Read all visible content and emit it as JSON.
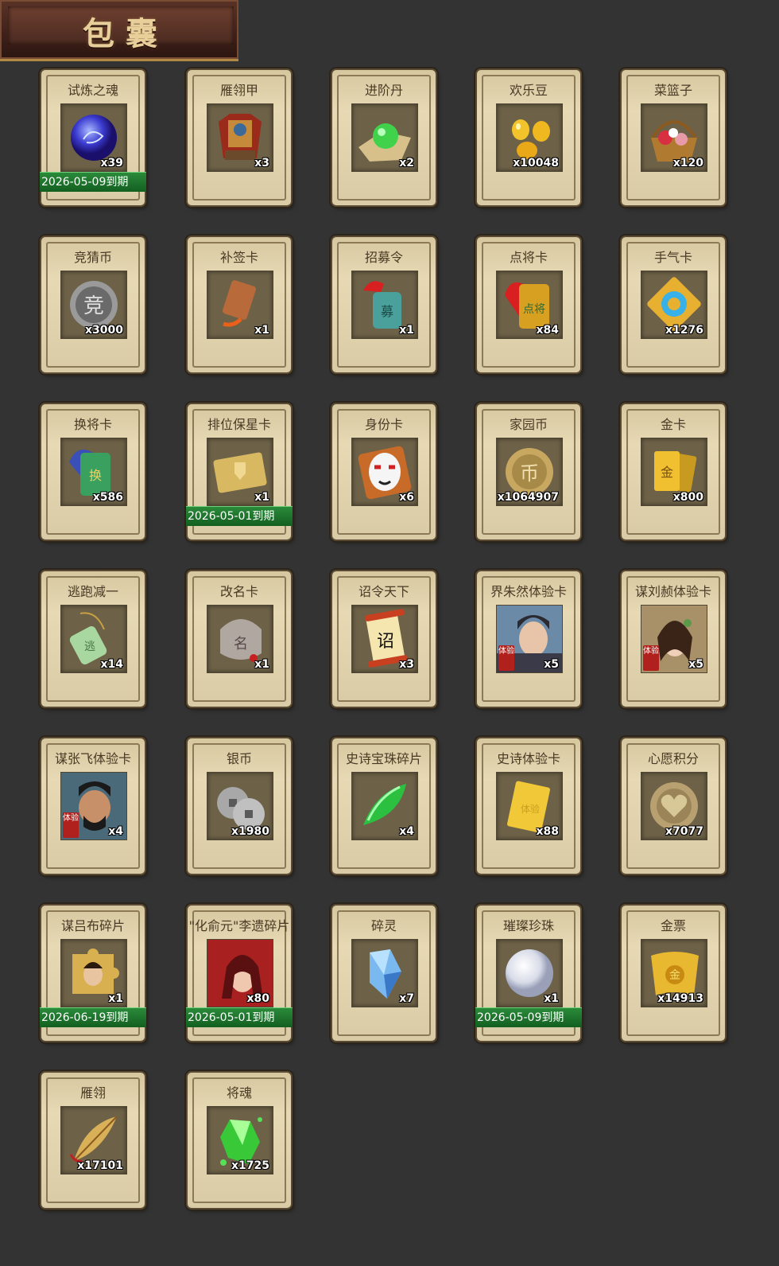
{
  "header": {
    "title": "包囊"
  },
  "items": [
    {
      "name": "试炼之魂",
      "qty": "x39",
      "expiry": "2026-05-09到期",
      "icon": "purple-orb-icon"
    },
    {
      "name": "雁翎甲",
      "qty": "x3",
      "expiry": "",
      "icon": "armor-icon"
    },
    {
      "name": "进阶丹",
      "qty": "x2",
      "expiry": "",
      "icon": "green-pill-icon"
    },
    {
      "name": "欢乐豆",
      "qty": "x10048",
      "expiry": "",
      "icon": "gold-beans-icon"
    },
    {
      "name": "菜篮子",
      "qty": "x120",
      "expiry": "",
      "icon": "flower-basket-icon"
    },
    {
      "name": "竞猜币",
      "qty": "x3000",
      "expiry": "",
      "icon": "silver-coin-icon"
    },
    {
      "name": "补签卡",
      "qty": "x1",
      "expiry": "",
      "icon": "tag-card-icon"
    },
    {
      "name": "招募令",
      "qty": "x1",
      "expiry": "",
      "icon": "recruit-token-icon"
    },
    {
      "name": "点将卡",
      "qty": "x84",
      "expiry": "",
      "icon": "general-card-icon"
    },
    {
      "name": "手气卡",
      "qty": "x1276",
      "expiry": "",
      "icon": "luck-card-icon"
    },
    {
      "name": "换将卡",
      "qty": "x586",
      "expiry": "",
      "icon": "swap-card-icon"
    },
    {
      "name": "排位保星卡",
      "qty": "x1",
      "expiry": "2026-05-01到期",
      "icon": "shield-card-icon"
    },
    {
      "name": "身份卡",
      "qty": "x6",
      "expiry": "",
      "icon": "identity-mask-icon"
    },
    {
      "name": "家园币",
      "qty": "x1064907",
      "expiry": "",
      "icon": "home-coin-icon"
    },
    {
      "name": "金卡",
      "qty": "x800",
      "expiry": "",
      "icon": "gold-card-icon"
    },
    {
      "name": "逃跑减一",
      "qty": "x14",
      "expiry": "",
      "icon": "jade-tablet-icon"
    },
    {
      "name": "改名卡",
      "qty": "x1",
      "expiry": "",
      "icon": "rename-card-icon"
    },
    {
      "name": "诏令天下",
      "qty": "x3",
      "expiry": "",
      "icon": "scroll-icon"
    },
    {
      "name": "界朱然体验卡",
      "qty": "x5",
      "expiry": "",
      "icon": "hero-portrait-icon",
      "trial": "体验"
    },
    {
      "name": "谋刘赪体验卡",
      "qty": "x5",
      "expiry": "",
      "icon": "heroine-portrait-icon",
      "trial": "体验"
    },
    {
      "name": "谋张飞体验卡",
      "qty": "x4",
      "expiry": "",
      "icon": "warrior-portrait-icon",
      "trial": "体验"
    },
    {
      "name": "银币",
      "qty": "x1980",
      "expiry": "",
      "icon": "silver-coins-icon"
    },
    {
      "name": "史诗宝珠碎片",
      "qty": "x4",
      "expiry": "",
      "icon": "green-shard-icon"
    },
    {
      "name": "史诗体验卡",
      "qty": "x88",
      "expiry": "",
      "icon": "epic-card-icon"
    },
    {
      "name": "心愿积分",
      "qty": "x7077",
      "expiry": "",
      "icon": "heart-coin-icon"
    },
    {
      "name": "谋吕布碎片",
      "qty": "x1",
      "expiry": "2026-06-19到期",
      "icon": "puzzle-piece-icon"
    },
    {
      "name": "\"化俞元\"李遗碎片",
      "qty": "x80",
      "expiry": "2026-05-01到期",
      "icon": "red-hero-portrait-icon"
    },
    {
      "name": "碎灵",
      "qty": "x7",
      "expiry": "",
      "icon": "blue-crystal-icon"
    },
    {
      "name": "璀璨珍珠",
      "qty": "x1",
      "expiry": "2026-05-09到期",
      "icon": "pearl-icon"
    },
    {
      "name": "金票",
      "qty": "x14913",
      "expiry": "",
      "icon": "gold-ticket-icon"
    },
    {
      "name": "雁翎",
      "qty": "x17101",
      "expiry": "",
      "icon": "feather-icon"
    },
    {
      "name": "将魂",
      "qty": "x1725",
      "expiry": "",
      "icon": "green-soul-icon"
    }
  ]
}
